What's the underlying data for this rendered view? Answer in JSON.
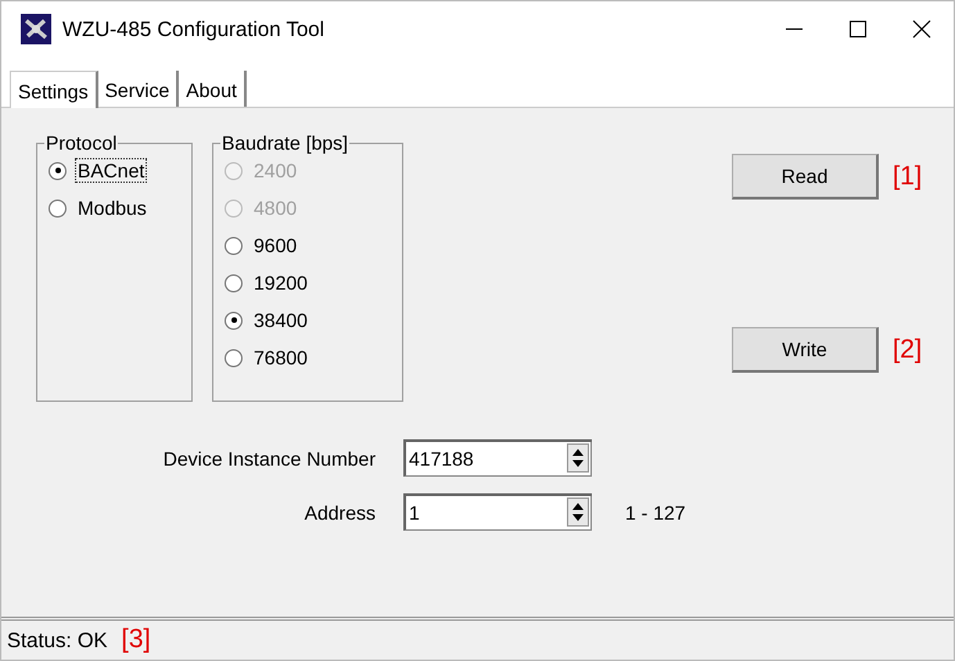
{
  "window": {
    "title": "WZU-485 Configuration Tool"
  },
  "tabs": [
    {
      "label": "Settings",
      "selected": true
    },
    {
      "label": "Service",
      "selected": false
    },
    {
      "label": "About",
      "selected": false
    }
  ],
  "protocol": {
    "title": "Protocol",
    "options": [
      {
        "label": "BACnet",
        "selected": true,
        "focused": true,
        "disabled": false
      },
      {
        "label": "Modbus",
        "selected": false,
        "focused": false,
        "disabled": false
      }
    ]
  },
  "baudrate": {
    "title": "Baudrate [bps]",
    "options": [
      {
        "label": "2400",
        "selected": false,
        "disabled": true
      },
      {
        "label": "4800",
        "selected": false,
        "disabled": true
      },
      {
        "label": "9600",
        "selected": false,
        "disabled": false
      },
      {
        "label": "19200",
        "selected": false,
        "disabled": false
      },
      {
        "label": "38400",
        "selected": true,
        "disabled": false
      },
      {
        "label": "76800",
        "selected": false,
        "disabled": false
      }
    ]
  },
  "buttons": [
    {
      "label": "Read",
      "callout": "[1]"
    },
    {
      "label": "Write",
      "callout": "[2]"
    }
  ],
  "fields": [
    {
      "label": "Device Instance Number",
      "value": "417188"
    },
    {
      "label": "Address",
      "value": "1",
      "range": "1 - 127"
    }
  ],
  "status_bar": {
    "text": "Status: OK",
    "callout": "[3]"
  }
}
